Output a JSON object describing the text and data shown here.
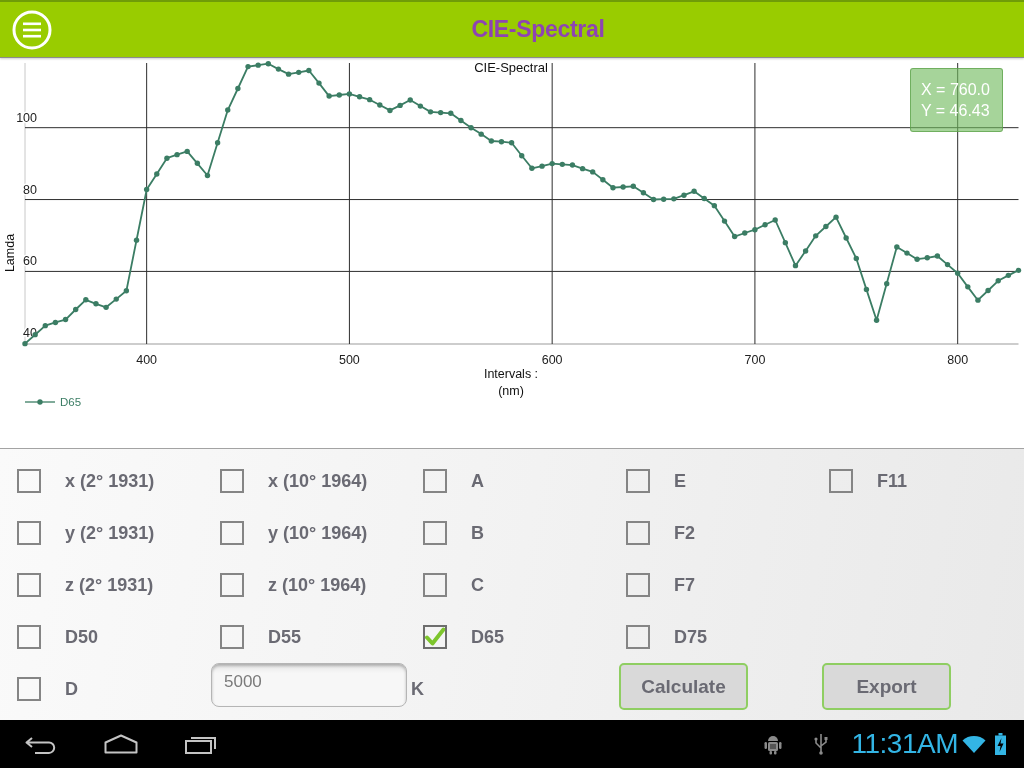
{
  "app_bar": {
    "title": "CIE-Spectral"
  },
  "chart": {
    "chart_data": {
      "type": "line",
      "title": "CIE-Spectral",
      "xlabel": "Intervals :\n(nm)",
      "ylabel": "Lamda",
      "x": [
        340,
        345,
        350,
        355,
        360,
        365,
        370,
        375,
        380,
        385,
        390,
        395,
        400,
        405,
        410,
        415,
        420,
        425,
        430,
        435,
        440,
        445,
        450,
        455,
        460,
        465,
        470,
        475,
        480,
        485,
        490,
        495,
        500,
        505,
        510,
        515,
        520,
        525,
        530,
        535,
        540,
        545,
        550,
        555,
        560,
        565,
        570,
        575,
        580,
        585,
        590,
        595,
        600,
        605,
        610,
        615,
        620,
        625,
        630,
        635,
        640,
        645,
        650,
        655,
        660,
        665,
        670,
        675,
        680,
        685,
        690,
        695,
        700,
        705,
        710,
        715,
        720,
        725,
        730,
        735,
        740,
        745,
        750,
        755,
        760,
        765,
        770,
        775,
        780,
        785,
        790,
        795,
        800,
        805,
        810,
        815,
        820,
        825,
        830
      ],
      "series": [
        {
          "name": "D65",
          "color": "#3b7d64",
          "values": [
            39.9,
            42.4,
            44.9,
            45.8,
            46.6,
            49.4,
            52.1,
            51.0,
            50.0,
            52.3,
            54.6,
            68.7,
            82.8,
            87.1,
            91.5,
            92.5,
            93.4,
            90.1,
            86.7,
            95.8,
            104.9,
            110.9,
            117.0,
            117.4,
            117.8,
            116.3,
            114.9,
            115.4,
            115.9,
            112.4,
            108.8,
            109.1,
            109.4,
            108.6,
            107.8,
            106.3,
            104.8,
            106.2,
            107.7,
            106.0,
            104.4,
            104.2,
            104.0,
            102.0,
            100.0,
            98.2,
            96.3,
            96.1,
            95.8,
            92.2,
            88.7,
            89.3,
            90.0,
            89.8,
            89.6,
            88.6,
            87.7,
            85.5,
            83.3,
            83.5,
            83.7,
            81.9,
            80.0,
            80.1,
            80.2,
            81.2,
            82.3,
            80.3,
            78.3,
            74.0,
            69.7,
            70.7,
            71.6,
            73.0,
            74.3,
            68.0,
            61.6,
            65.7,
            69.9,
            72.5,
            75.1,
            69.3,
            63.6,
            55.0,
            46.4,
            56.6,
            66.8,
            65.1,
            63.4,
            63.8,
            64.3,
            61.9,
            59.5,
            55.7,
            52.0,
            54.7,
            57.4,
            58.9,
            60.3
          ]
        }
      ],
      "xlim": [
        340,
        830
      ],
      "ylim": [
        39.8,
        118
      ],
      "xticks": [
        400,
        500,
        600,
        700,
        800
      ],
      "yticks": [
        40,
        60,
        80,
        100
      ],
      "grid": true
    },
    "tooltip": {
      "lines": [
        "X = 760.0",
        "Y = 46.43"
      ]
    }
  },
  "options": {
    "rows": [
      [
        {
          "label": "x (2° 1931)",
          "checked": false
        },
        {
          "label": "x (10° 1964)",
          "checked": false
        },
        {
          "label": "A",
          "checked": false
        },
        {
          "label": "E",
          "checked": false
        },
        {
          "label": "F11",
          "checked": false
        }
      ],
      [
        {
          "label": "y (2° 1931)",
          "checked": false
        },
        {
          "label": "y (10° 1964)",
          "checked": false
        },
        {
          "label": "B",
          "checked": false
        },
        {
          "label": "F2",
          "checked": false
        }
      ],
      [
        {
          "label": "z (2° 1931)",
          "checked": false
        },
        {
          "label": "z (10° 1964)",
          "checked": false
        },
        {
          "label": "C",
          "checked": false
        },
        {
          "label": "F7",
          "checked": false
        }
      ],
      [
        {
          "label": "D50",
          "checked": false
        },
        {
          "label": "D55",
          "checked": false
        },
        {
          "label": "D65",
          "checked": true
        },
        {
          "label": "D75",
          "checked": false
        }
      ]
    ],
    "temperature_row": {
      "checkbox": {
        "label": "D",
        "checked": false
      },
      "temperature_field": {
        "value": "5000"
      },
      "unit": "K"
    },
    "buttons": [
      {
        "label": "Calculate"
      },
      {
        "label": "Export"
      }
    ]
  },
  "system_bar": {
    "time": "11:31AM"
  }
}
